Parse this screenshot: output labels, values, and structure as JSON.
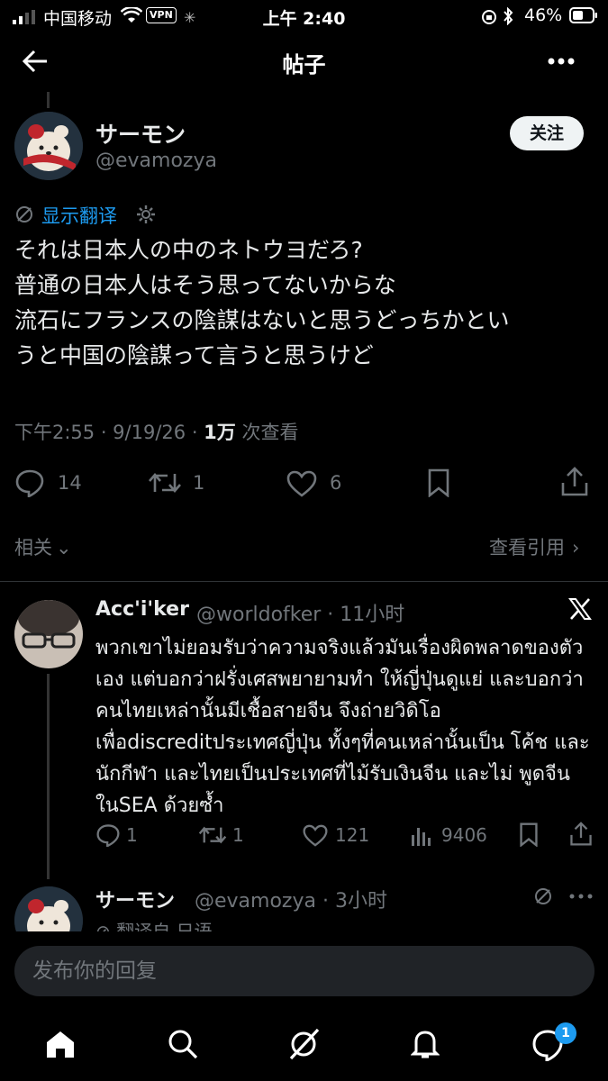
{
  "status_bar": {
    "carrier": "中国移动",
    "vpn": "VPN",
    "time": "上午 2:40",
    "battery": "46%"
  },
  "header": {
    "title": "帖子"
  },
  "tweet": {
    "display_name": "サーモン",
    "handle": "@evamozya",
    "follow_label": "关注",
    "translate_label": "显示翻译",
    "text": "それは日本人の中のネトウヨだろ?\n普通の日本人はそう思ってないからな\n流石にフランスの陰謀はないと思うどっちかとい\nうと中国の陰謀って言うと思うけど",
    "timestamp": "下午2:55 · 9/19/26 · ",
    "views_count": "1万",
    "views_label": " 次查看",
    "replies": "14",
    "reposts": "1",
    "likes": "6"
  },
  "related": {
    "label": "相关",
    "quotes_label": "查看引用"
  },
  "reply": {
    "display_name": "Acc'i'ker",
    "handle_time": "@worldofker · 11小时",
    "text": "พวกเขาไม่ยอมรับว่าความจริงแล้วมันเรื่องผิดพลาดของตัวเอง แต่บอกว่าฝรั่งเศสพยายามทำ ให้ญี่ปุ่นดูแย่ และบอกว่าคนไทยเหล่านั้นมีเชื้อสายจีน จึงถ่ายวิดิโอ เพื่อdiscreditประเทศญี่ปุ่น ทั้งๆที่คนเหล่านั้นเป็น โค้ช และนักกีฬา และไทยเป็นประเทศที่ไม้รับเงินจีน และไม่ พูดจีน ในSEA ด้วยซ้ำ",
    "replies": "1",
    "reposts": "1",
    "likes": "121",
    "views": "9406"
  },
  "next_reply": {
    "display_name": "サーモン",
    "handle_time": "@evamozya · 3小时",
    "translated_label": "翻译自 日语"
  },
  "compose": {
    "placeholder": "发布你的回复"
  },
  "bottom_nav": {
    "notification_badge": "1"
  }
}
